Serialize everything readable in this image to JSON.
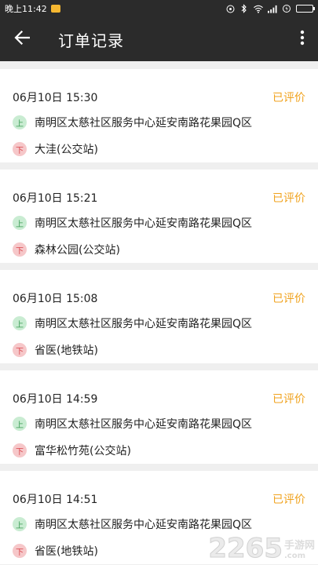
{
  "status_bar": {
    "time": "晚上11:42",
    "icons": [
      "alarm-icon",
      "bluetooth-icon",
      "wifi-icon",
      "signal-icon",
      "charging-icon",
      "battery-icon"
    ]
  },
  "header": {
    "title": "订单记录",
    "back_icon": "arrow-left-icon",
    "more_icon": "more-vert-icon"
  },
  "badges": {
    "pickup": "上",
    "dropoff": "下"
  },
  "colors": {
    "status": "#f0a21c",
    "pickup_badge": "#c9ecd2",
    "dropoff_badge": "#f6c7c9",
    "bar": "#2b2b2b"
  },
  "orders": [
    {
      "time": "06月10日 15:30",
      "status": "已评价",
      "from": "南明区太慈社区服务中心延安南路花果园Q区",
      "to": "大洼(公交站)"
    },
    {
      "time": "06月10日 15:21",
      "status": "已评价",
      "from": "南明区太慈社区服务中心延安南路花果园Q区",
      "to": "森林公园(公交站)"
    },
    {
      "time": "06月10日 15:08",
      "status": "已评价",
      "from": "南明区太慈社区服务中心延安南路花果园Q区",
      "to": "省医(地铁站)"
    },
    {
      "time": "06月10日 14:59",
      "status": "已评价",
      "from": "南明区太慈社区服务中心延安南路花果园Q区",
      "to": "富华松竹苑(公交站)"
    },
    {
      "time": "06月10日 14:51",
      "status": "已评价",
      "from": "南明区太慈社区服务中心延安南路花果园Q区",
      "to": "省医(地铁站)"
    }
  ],
  "watermark": {
    "number": "2265",
    "cn": "手游网",
    "domain": ".com"
  }
}
